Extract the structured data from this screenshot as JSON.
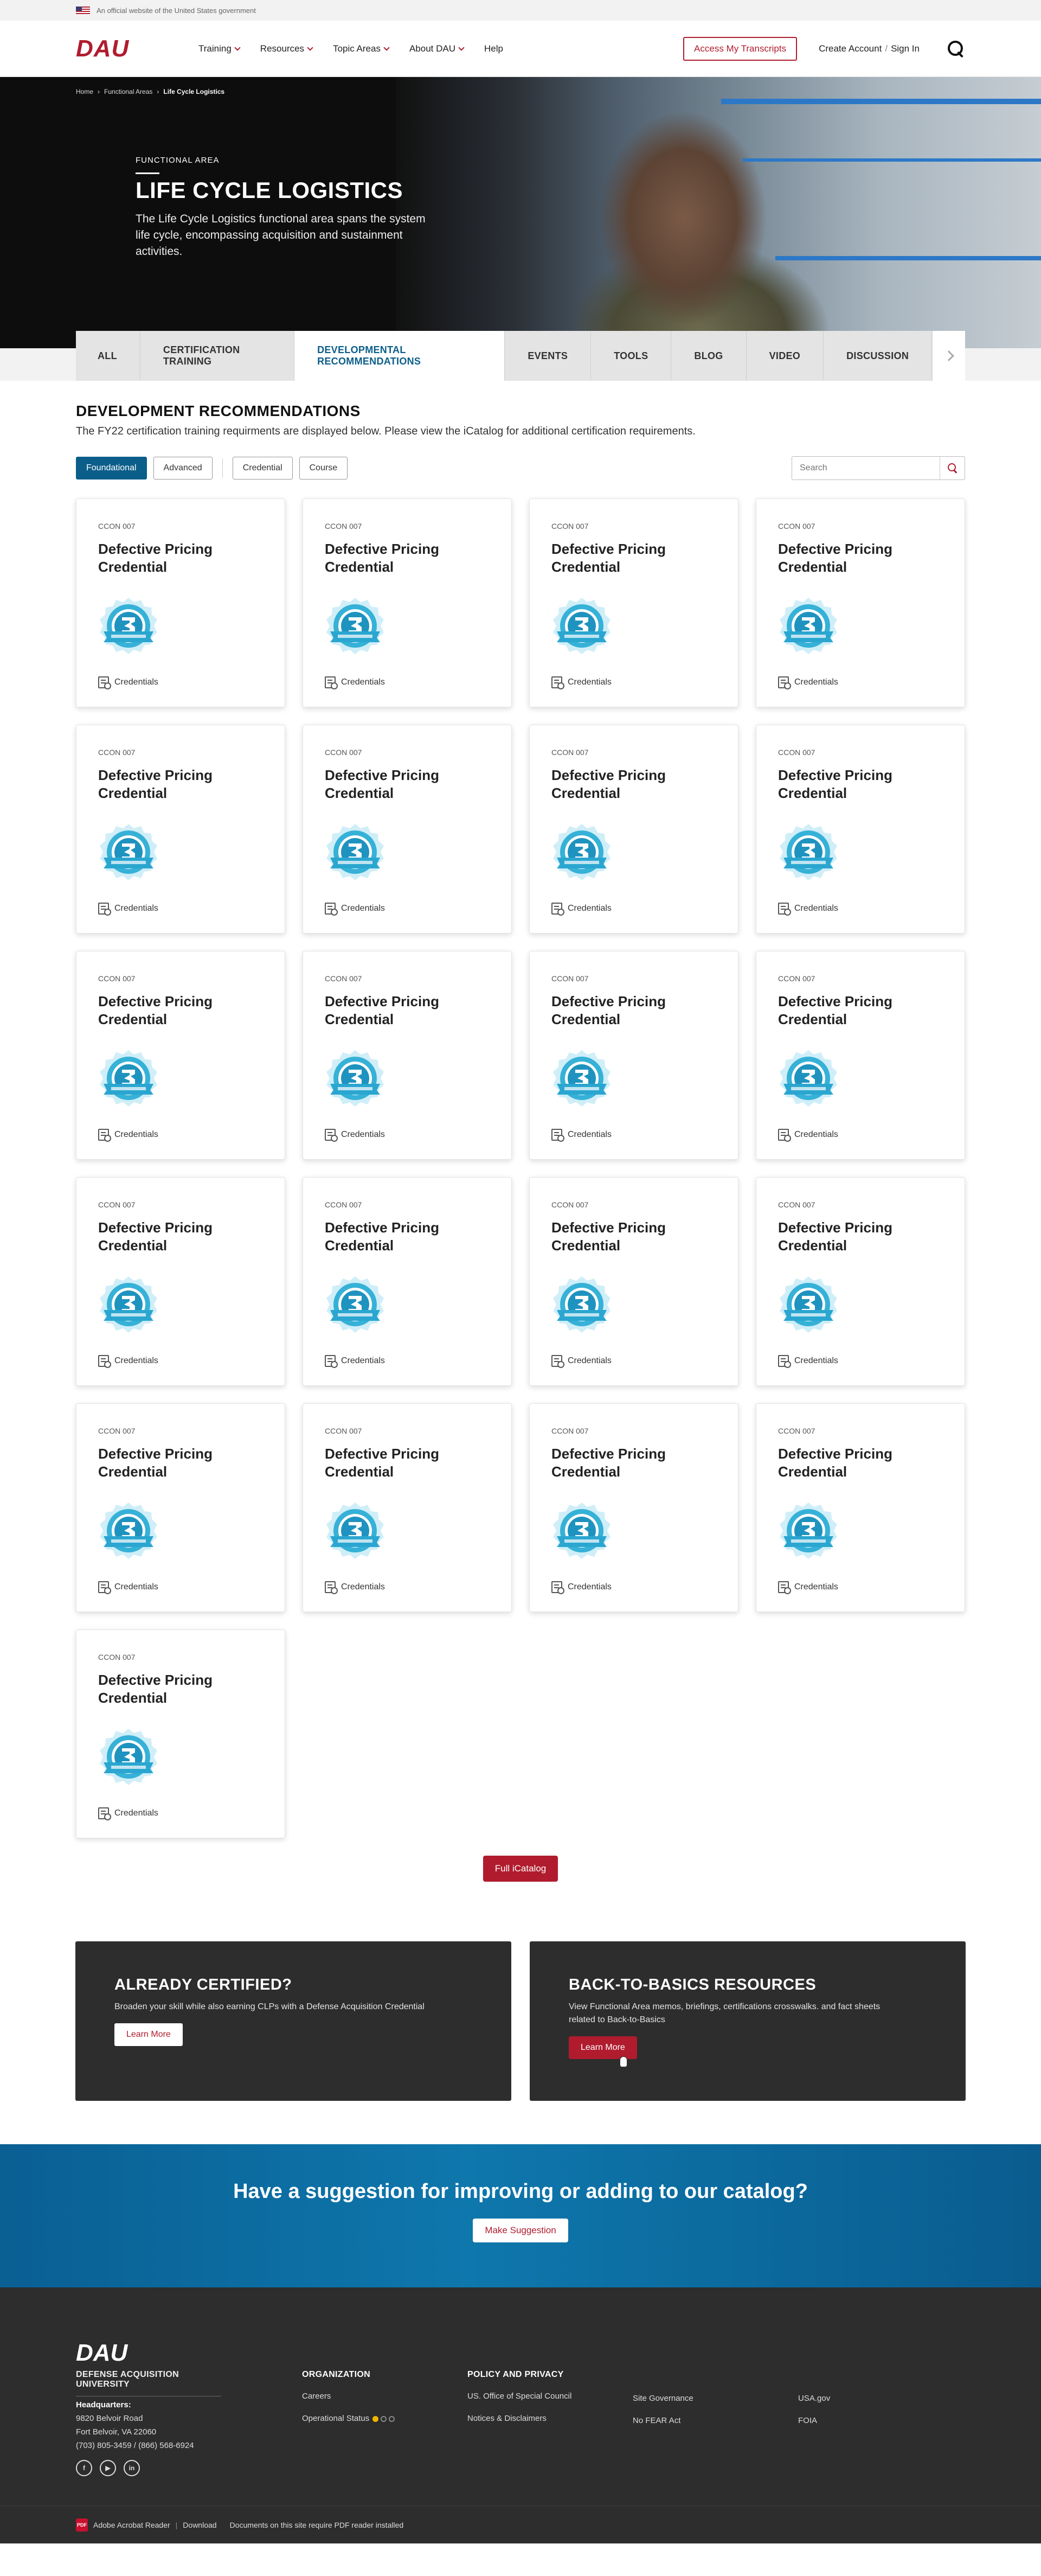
{
  "gov_banner": {
    "text": "An official website of the United States government"
  },
  "header": {
    "logo": "DAU",
    "nav": [
      {
        "label": "Training"
      },
      {
        "label": "Resources"
      },
      {
        "label": "Topic Areas"
      },
      {
        "label": "About DAU"
      },
      {
        "label": "Help"
      }
    ],
    "transcripts_button": "Access My Transcripts",
    "create_account": "Create Account",
    "separator": "/",
    "sign_in": "Sign In"
  },
  "breadcrumb": {
    "home": "Home",
    "functional_areas": "Functional Areas",
    "current": "Life Cycle Logistics"
  },
  "hero": {
    "eyebrow": "FUNCTIONAL AREA",
    "title": "LIFE CYCLE LOGISTICS",
    "description": "The Life Cycle Logistics functional area spans the system life cycle, encompassing acquisition and sustainment activities."
  },
  "tabs": [
    {
      "label": "ALL"
    },
    {
      "label": "CERTIFICATION TRAINING"
    },
    {
      "label": "DEVELOPMENTAL RECOMMENDATIONS"
    },
    {
      "label": "EVENTS"
    },
    {
      "label": "TOOLS"
    },
    {
      "label": "BLOG"
    },
    {
      "label": "VIDEO"
    },
    {
      "label": "DISCUSSION"
    }
  ],
  "section": {
    "title": "DEVELOPMENT RECOMMENDATIONS",
    "description": "The FY22 certification training requirments are displayed below. Please view the iCatalog for additional certification requirements."
  },
  "filters": {
    "level": [
      "Foundational",
      "Advanced"
    ],
    "type": [
      "Credential",
      "Course"
    ],
    "search_placeholder": "Search"
  },
  "card": {
    "code": "CCON 007",
    "title": "Defective Pricing Credential",
    "footer": "Credentials"
  },
  "card_count": 21,
  "full_catalog_button": "Full iCatalog",
  "promos": [
    {
      "title": "ALREADY CERTIFIED?",
      "text": "Broaden your skill while also earning CLPs with a Defense Acquisition Credential",
      "button": "Learn More"
    },
    {
      "title": "BACK-TO-BASICS RESOURCES",
      "text": "View Functional Area memos, briefings, certifications crosswalks. and fact sheets related to Back-to-Basics",
      "button": "Learn More"
    }
  ],
  "suggestion": {
    "title": "Have a suggestion for improving or adding to our catalog?",
    "button": "Make Suggestion"
  },
  "footer": {
    "logo": "DAU",
    "org_name": "DEFENSE ACQUISITION UNIVERSITY",
    "hq_label": "Headquarters:",
    "address1": "9820 Belvoir Road",
    "address2": "Fort Belvoir, VA 22060",
    "phone": "(703) 805-3459 / (866) 568-6924",
    "organization": {
      "heading": "ORGANIZATION",
      "links": [
        "Careers",
        "Operational Status"
      ]
    },
    "policy": {
      "heading": "POLICY AND PRIVACY",
      "col1": [
        "US. Office of Special Council",
        "Notices & Disclaimers"
      ],
      "col2": [
        "Site Governance",
        "No FEAR Act"
      ],
      "col3": [
        "USA.gov",
        "FOIA"
      ]
    },
    "acrobat": "Adobe Acrobat Reader",
    "download": "Download",
    "pdf_note": "Documents on this site require PDF reader installed",
    "pdf_icon": "PDF"
  },
  "colors": {
    "brand_red": "#b01c2e",
    "accent_blue": "#0b5e8a",
    "dark": "#2d2d2d"
  }
}
